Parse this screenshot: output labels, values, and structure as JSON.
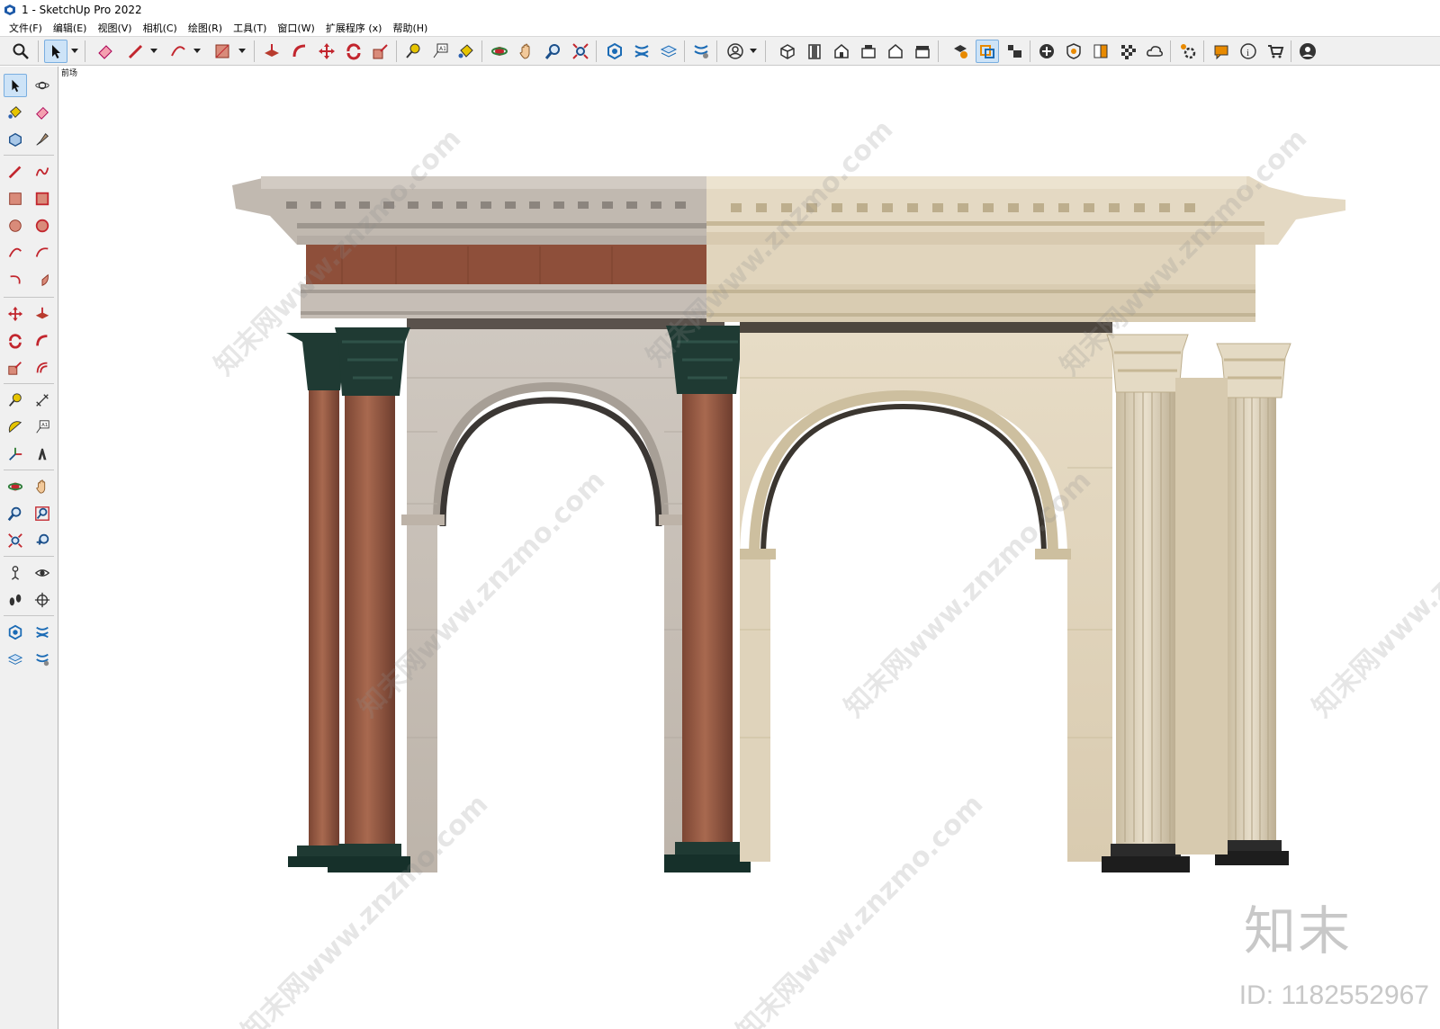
{
  "window": {
    "title": "1 - SketchUp Pro 2022"
  },
  "menu": [
    "文件(F)",
    "编辑(E)",
    "视图(V)",
    "相机(C)",
    "绘图(R)",
    "工具(T)",
    "窗口(W)",
    "扩展程序 (x)",
    "帮助(H)"
  ],
  "toolbar": {
    "icons": [
      "search-icon",
      "select-icon",
      "eraser-icon",
      "pencil-icon",
      "arc-icon",
      "rectangle-icon",
      "push-pull-icon",
      "follow-me-icon",
      "move-icon",
      "rotate-icon",
      "scale-icon",
      "tape-measure-icon",
      "text-icon",
      "paint-bucket-icon",
      "orbit-icon",
      "pan-icon",
      "zoom-icon",
      "zoom-extents-icon",
      "warehouse-icon",
      "extension-icon",
      "layers-icon",
      "styles-icon",
      "account-icon",
      "iso-view-icon",
      "top-view-icon",
      "front-view-icon",
      "right-view-icon",
      "back-view-icon",
      "left-view-icon",
      "section-plane-icon",
      "section-fill-icon",
      "section-cut-icon",
      "add-icon",
      "solid-inspector-icon",
      "material-icon",
      "checker-icon",
      "cloud-icon",
      "settings-icon",
      "message-icon",
      "info-icon",
      "cart-icon",
      "user-icon"
    ]
  },
  "left_toolbar": {
    "icons": [
      "select-icon",
      "orbit-icon",
      "paint-bucket-icon",
      "eraser-icon",
      "component-icon",
      "tag-icon",
      "line-icon",
      "freehand-icon",
      "rectangle-icon",
      "rotated-rectangle-icon",
      "circle-icon",
      "polygon-icon",
      "arc-icon",
      "pie-icon",
      "arc-3pt-icon",
      "pie-3pt-icon",
      "move-icon",
      "push-pull-icon",
      "rotate-icon",
      "follow-me-icon",
      "scale-icon",
      "offset-icon",
      "tape-measure-icon",
      "axes-icon",
      "protractor-icon",
      "text-icon",
      "3d-text-icon",
      "dimension-icon",
      "orbit-icon",
      "pan-icon",
      "zoom-icon",
      "zoom-window-icon",
      "zoom-extents-icon",
      "previous-view-icon",
      "position-camera-icon",
      "look-around-icon",
      "walk-icon",
      "section-plane-icon",
      "warehouse-icon",
      "extension-warehouse-icon",
      "layers-icon",
      "styles-icon"
    ]
  },
  "viewport": {
    "scene_tab": "前场",
    "model": "classical-arcade-with-corinthian-columns"
  },
  "watermark": {
    "text": "知末网www.znzmo.com",
    "logo": "知末",
    "id": "ID: 1182552967"
  },
  "colors": {
    "column_brown": "#9a5e47",
    "capital_green": "#1f3a33",
    "stone_gray": "#c9c1b8",
    "travertine": "#e3d7c0",
    "frieze_brown": "#8e4f3a",
    "toolbar_bg": "#f0f0f0",
    "active_tool": "#cde3f7"
  }
}
